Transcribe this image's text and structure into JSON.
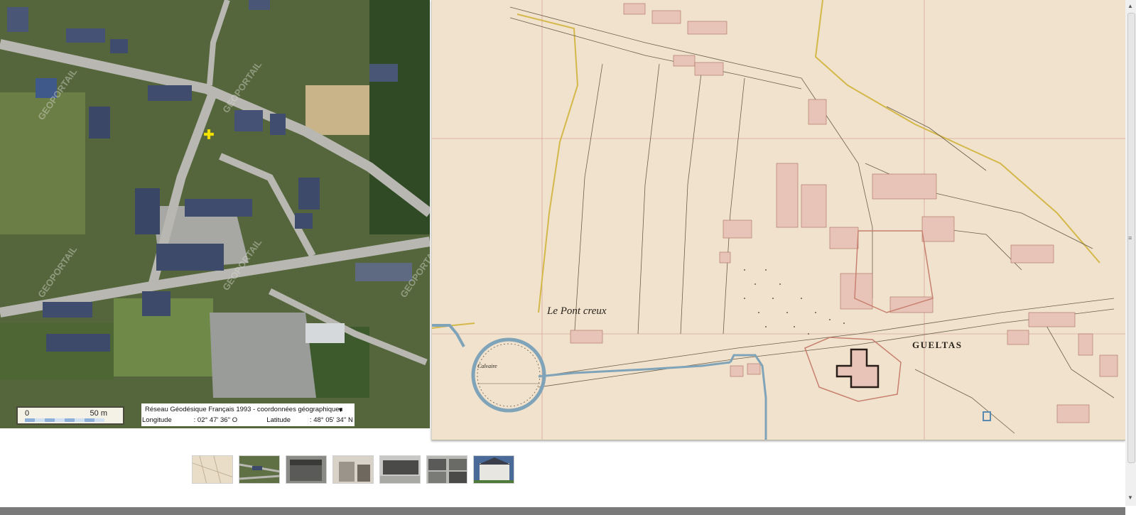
{
  "aerial_map": {
    "watermark": "GEOPORTAIL",
    "scale": {
      "zero": "0",
      "distance": "50 m"
    },
    "coordinates": {
      "system": "Réseau Géodésique Français 1993 - coordonnées géographiques",
      "longitude_label": "Longitude",
      "longitude_value": ": 02° 47' 36'' O",
      "latitude_label": "Latitude",
      "latitude_value": ": 48° 05' 34'' N"
    }
  },
  "cadastre_map": {
    "place_labels": {
      "pontcreux": "Le Pont creux",
      "gueltas": "GUELTAS",
      "calvaire": "Calvaire"
    }
  },
  "thumbnails": [
    {
      "name": "cadastre-map-thumbnail"
    },
    {
      "name": "aerial-photo-thumbnail"
    },
    {
      "name": "old-photo-1-thumbnail"
    },
    {
      "name": "old-photo-2-thumbnail"
    },
    {
      "name": "old-photo-3-thumbnail"
    },
    {
      "name": "old-photo-4-thumbnail"
    },
    {
      "name": "modern-photo-thumbnail"
    }
  ],
  "colors": {
    "cadastre_paper": "#f0e2cc",
    "cadastre_building": "#e8c4b8",
    "water": "#7fa3b8",
    "position_marker": "#f5e400"
  }
}
